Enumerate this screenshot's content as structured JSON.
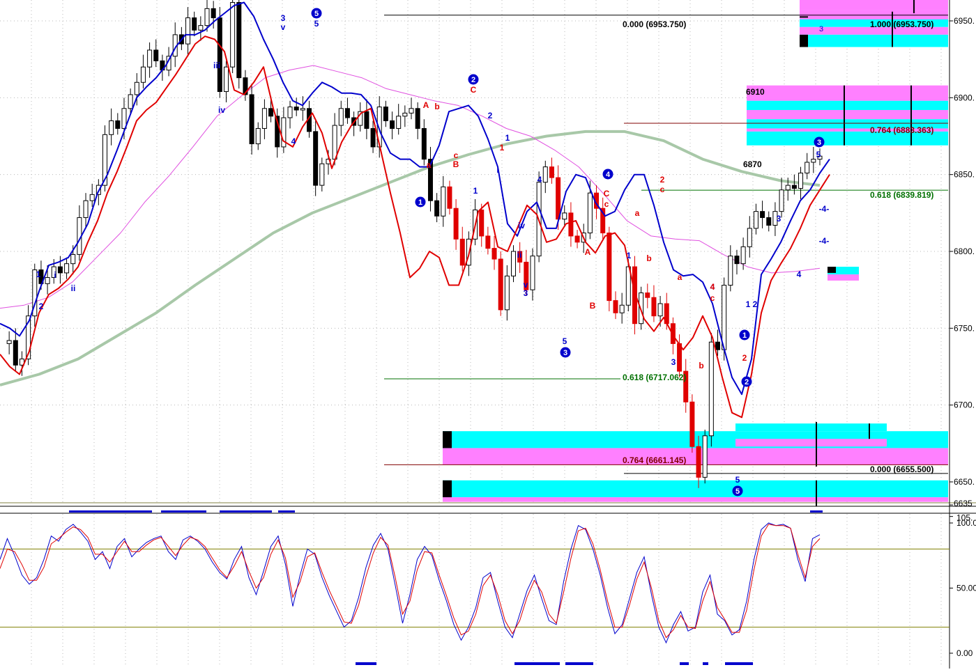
{
  "colors": {
    "background": "#ffffff",
    "grid": "#b8b8b8",
    "bullish_candle": "#ffffff",
    "bearish_candle": "#000000",
    "blue_band": "#0000cc",
    "red_band": "#e00000",
    "magenta_ma": "#e050e0",
    "green_ma": "#a8c8a8",
    "cyan_zone": "#00ffff",
    "pink_zone": "#ff80ff",
    "fib_dark_red": "#800000",
    "fib_green": "#007000",
    "stoch_ref": "#808000",
    "wave_blue": "#0000cc",
    "wave_red": "#e00000"
  },
  "chart_data": [
    {
      "type": "candlestick",
      "panel": "price",
      "ylim": [
        6635,
        6967
      ],
      "price_axis_ticks": [
        "6950.",
        "6900.",
        "6850.",
        "6800.",
        "6750.",
        "6700.",
        "6650.",
        "6635"
      ],
      "price_axis_values": [
        6950,
        6900,
        6850,
        6800,
        6750,
        6700,
        6650,
        6635
      ],
      "grid": true,
      "price_path": [
        6740,
        6742,
        6726,
        6730,
        6758,
        6788,
        6779,
        6783,
        6790,
        6786,
        6792,
        6798,
        6822,
        6833,
        6837,
        6843,
        6876,
        6885,
        6880,
        6893,
        6902,
        6910,
        6920,
        6931,
        6924,
        6918,
        6927,
        6941,
        6935,
        6952,
        6944,
        6947,
        6958,
        6952,
        6904,
        6920,
        6962,
        6913,
        6902,
        6870,
        6880,
        6893,
        6888,
        6868,
        6887,
        6894,
        6892,
        6893,
        6878,
        6843,
        6857,
        6860,
        6882,
        6893,
        6887,
        6882,
        6891,
        6880,
        6868,
        6894,
        6885,
        6880,
        6888,
        6890,
        6893,
        6880,
        6860,
        6833,
        6823,
        6842,
        6828,
        6808,
        6791,
        6808,
        6827,
        6810,
        6802,
        6795,
        6762,
        6784,
        6800,
        6793,
        6775,
        6797,
        6845,
        6855,
        6848,
        6821,
        6825,
        6810,
        6806,
        6812,
        6838,
        6828,
        6812,
        6768,
        6760,
        6765,
        6790,
        6753,
        6773,
        6770,
        6758,
        6766,
        6753,
        6740,
        6722,
        6702,
        6673,
        6653,
        6680,
        6741,
        6736,
        6778,
        6797,
        6792,
        6803,
        6815,
        6826,
        6822,
        6817,
        6826,
        6840,
        6843,
        6841,
        6851,
        6858,
        6860,
        6862
      ],
      "volatility_bands": {
        "blue_upper": [
          6753,
          6750,
          6745,
          6755,
          6774,
          6791,
          6793,
          6796,
          6806,
          6818,
          6838,
          6850,
          6866,
          6883,
          6900,
          6907,
          6913,
          6921,
          6933,
          6941,
          6941,
          6944,
          6950,
          6955,
          6960,
          6962,
          6953,
          6938,
          6925,
          6910,
          6898,
          6895,
          6903,
          6910,
          6907,
          6903,
          6903,
          6902,
          6895,
          6877,
          6864,
          6860,
          6860,
          6855,
          6855,
          6869,
          6891,
          6893,
          6895,
          6888,
          6873,
          6855,
          6818,
          6810,
          6826,
          6832,
          6815,
          6815,
          6839,
          6850,
          6848,
          6832,
          6823,
          6826,
          6840,
          6850,
          6850,
          6830,
          6806,
          6788,
          6784,
          6785,
          6780,
          6766,
          6741,
          6718,
          6707,
          6730,
          6785,
          6795,
          6806,
          6820,
          6833,
          6840,
          6851,
          6860
        ],
        "red_lower": [
          6733,
          6725,
          6720,
          6735,
          6760,
          6772,
          6776,
          6782,
          6790,
          6806,
          6820,
          6838,
          6852,
          6868,
          6885,
          6892,
          6897,
          6906,
          6915,
          6925,
          6935,
          6940,
          6938,
          6930,
          6905,
          6902,
          6910,
          6920,
          6893,
          6872,
          6868,
          6881,
          6890,
          6877,
          6854,
          6871,
          6882,
          6890,
          6893,
          6866,
          6838,
          6812,
          6783,
          6789,
          6800,
          6796,
          6778,
          6778,
          6797,
          6826,
          6832,
          6803,
          6800,
          6815,
          6830,
          6824,
          6806,
          6808,
          6818,
          6820,
          6806,
          6799,
          6810,
          6812,
          6804,
          6774,
          6756,
          6748,
          6757,
          6745,
          6736,
          6744,
          6758,
          6744,
          6718,
          6695,
          6692,
          6720,
          6760,
          6781,
          6792,
          6802,
          6815,
          6830,
          6840,
          6850
        ]
      },
      "moving_averages": {
        "magenta": [
          6763,
          6765,
          6770,
          6780,
          6796,
          6812,
          6832,
          6849,
          6868,
          6888,
          6901,
          6913,
          6918,
          6921,
          6917,
          6913,
          6906,
          6902,
          6898,
          6895,
          6888,
          6880,
          6875,
          6866,
          6855,
          6838,
          6820,
          6810,
          6808,
          6807,
          6798,
          6790,
          6786,
          6787,
          6789
        ],
        "green": [
          6713,
          6720,
          6730,
          6745,
          6760,
          6778,
          6795,
          6812,
          6825,
          6835,
          6845,
          6855,
          6863,
          6870,
          6875,
          6878,
          6878,
          6872,
          6860,
          6852,
          6846,
          6843
        ]
      },
      "fibonacci_levels": [
        {
          "label": "0.000 (6953.750)",
          "price": 6953.75
        },
        {
          "label": "0.618 (6717.062)",
          "price": 6717.062
        },
        {
          "label": "0.764 (6661.145)",
          "price": 6661.145
        },
        {
          "label": "1.000 (6953.750)",
          "price": 6953.75
        },
        {
          "label": "0.764 (6883.363)",
          "price": 6883.363
        },
        {
          "label": "0.618 (6839.819)",
          "price": 6839.819
        },
        {
          "label": "0.000 (6655.500)",
          "price": 6655.5
        }
      ],
      "price_annotations": [
        "6910",
        "6870"
      ],
      "wave_labels": {
        "blue": [
          "3",
          "v",
          "5",
          "4",
          "iii",
          "iv",
          "1",
          "i",
          "2",
          "ii",
          "1",
          "2",
          "1",
          "i",
          "v",
          "3",
          "ii",
          "iv",
          "4",
          "5",
          "1",
          "2",
          "3",
          "4",
          "1",
          "2",
          "3",
          "4",
          "5",
          "5",
          "-4-",
          "-4-"
        ],
        "red": [
          "A",
          "b",
          "a",
          "c",
          "B",
          "C",
          "A",
          "B",
          "a",
          "b",
          "c",
          "C",
          "2",
          "c",
          "a",
          "b",
          "4",
          "c",
          "1",
          "2"
        ],
        "circled": [
          "5",
          "1",
          "2",
          "3",
          "4",
          "1",
          "2",
          "5",
          "3"
        ]
      }
    },
    {
      "type": "line",
      "panel": "stochastic",
      "ylim": [
        0,
        105
      ],
      "axis_ticks": [
        "105.",
        "100.00",
        "50.00",
        "0.00"
      ],
      "axis_values": [
        105,
        100,
        50,
        0
      ],
      "reference_levels": [
        80,
        20
      ],
      "series": [
        {
          "color": "#0000cc",
          "values": [
            72,
            88,
            75,
            60,
            53,
            58,
            72,
            90,
            86,
            95,
            99,
            93,
            86,
            72,
            78,
            65,
            82,
            88,
            74,
            80,
            85,
            88,
            90,
            78,
            72,
            87,
            90,
            86,
            80,
            70,
            62,
            57,
            72,
            82,
            58,
            45,
            63,
            82,
            90,
            68,
            36,
            60,
            80,
            76,
            58,
            44,
            32,
            20,
            25,
            43,
            66,
            83,
            92,
            80,
            52,
            23,
            45,
            72,
            82,
            75,
            56,
            40,
            22,
            10,
            20,
            35,
            58,
            62,
            40,
            20,
            12,
            30,
            48,
            60,
            42,
            25,
            22,
            55,
            80,
            98,
            95,
            80,
            60,
            35,
            15,
            22,
            42,
            62,
            74,
            45,
            20,
            8,
            22,
            32,
            17,
            20,
            47,
            60,
            30,
            25,
            14,
            18,
            40,
            72,
            95,
            100,
            98,
            99,
            96,
            72,
            55,
            88,
            91
          ]
        },
        {
          "color": "#e00000",
          "values": [
            65,
            80,
            78,
            68,
            56,
            56,
            66,
            84,
            88,
            93,
            97,
            95,
            89,
            76,
            76,
            70,
            78,
            86,
            78,
            78,
            83,
            87,
            89,
            82,
            75,
            83,
            89,
            87,
            82,
            73,
            64,
            58,
            67,
            78,
            63,
            50,
            58,
            76,
            87,
            73,
            43,
            55,
            74,
            77,
            62,
            48,
            36,
            24,
            23,
            37,
            59,
            77,
            89,
            83,
            58,
            30,
            40,
            64,
            78,
            77,
            60,
            44,
            27,
            14,
            17,
            30,
            52,
            60,
            45,
            25,
            15,
            25,
            43,
            56,
            47,
            30,
            23,
            47,
            73,
            94,
            96,
            84,
            64,
            40,
            20,
            20,
            37,
            57,
            70,
            50,
            25,
            12,
            18,
            29,
            20,
            19,
            40,
            55,
            35,
            26,
            16,
            16,
            33,
            64,
            90,
            99,
            98,
            98,
            96,
            76,
            58,
            82,
            88
          ]
        }
      ]
    }
  ]
}
